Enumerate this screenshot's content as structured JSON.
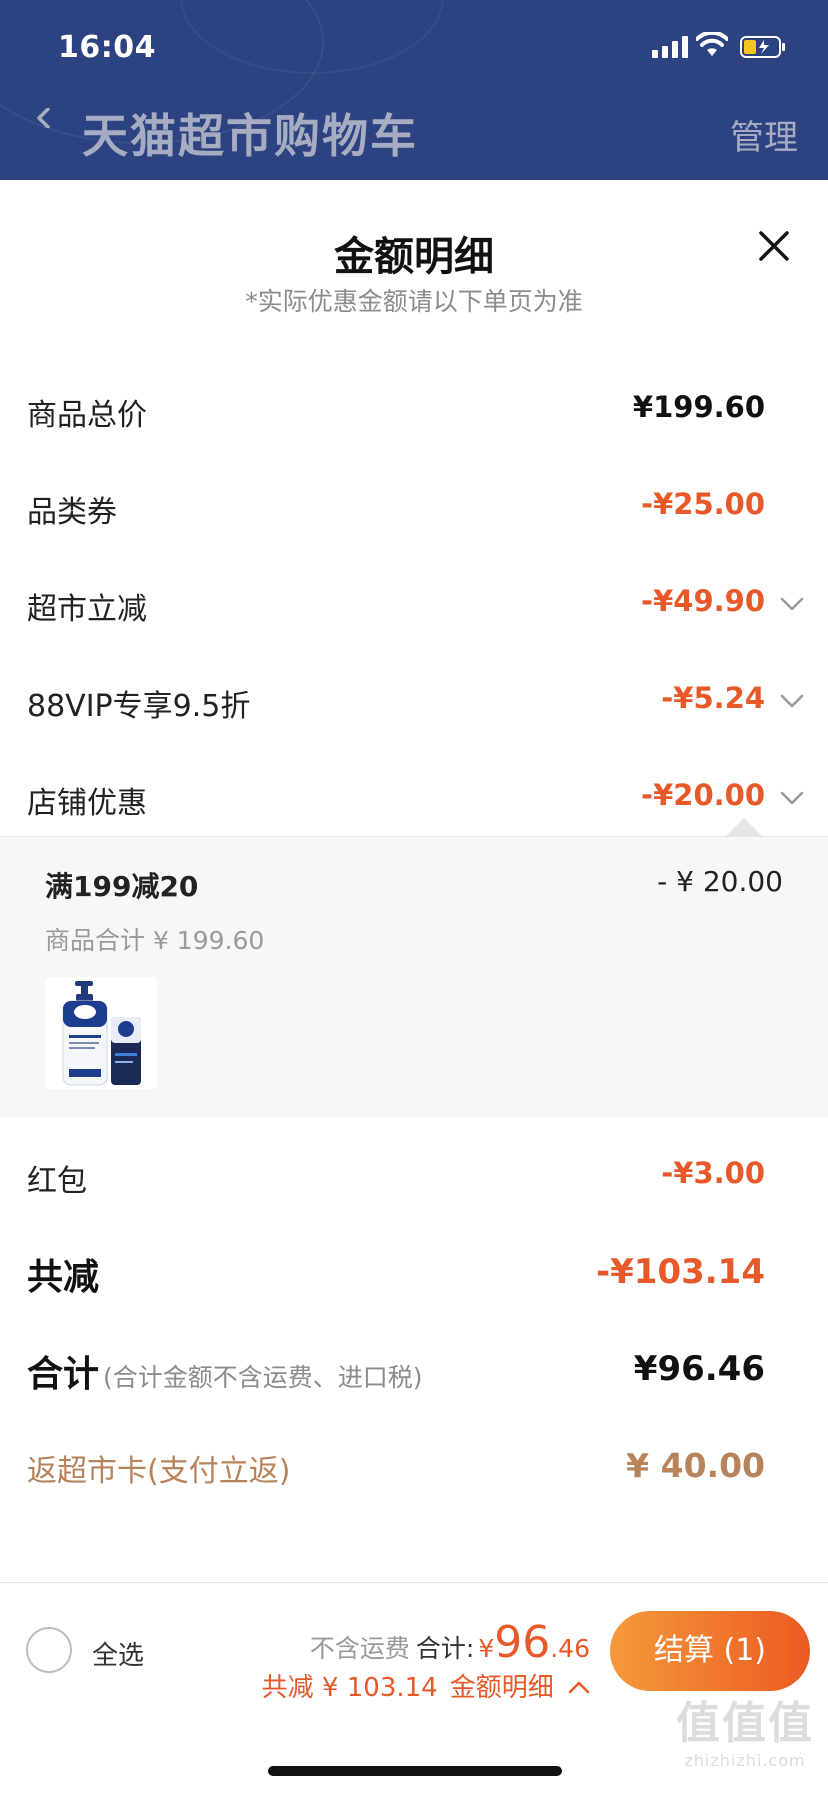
{
  "status_bar": {
    "time": "16:04"
  },
  "nav": {
    "title": "天猫超市购物车",
    "manage_label": "管理"
  },
  "sheet": {
    "title": "金额明细",
    "subtitle": "*实际优惠金额请以下单页为准"
  },
  "rows": {
    "goods_total": {
      "label": "商品总价",
      "value": "¥199.60"
    },
    "category_coupon": {
      "label": "品类券",
      "value": "-¥25.00"
    },
    "market_discount": {
      "label": "超市立减",
      "value": "-¥49.90"
    },
    "vip_discount": {
      "label": "88VIP专享9.5折",
      "value": "-¥5.24"
    },
    "store_discount": {
      "label": "店铺优惠",
      "value": "-¥20.00"
    },
    "red_packet": {
      "label": "红包",
      "value": "-¥3.00"
    },
    "total_saved": {
      "label": "共减",
      "value": "-¥103.14"
    },
    "subtotal": {
      "label": "合计",
      "note": "(合计金额不含运费、进口税)",
      "value": "¥96.46"
    },
    "cashback": {
      "label": "返超市卡(支付立返)",
      "value": "¥ 40.00"
    }
  },
  "store_promo": {
    "title": "满199减20",
    "amount": "- ¥ 20.00",
    "subtotal": "商品合计 ¥ 199.60"
  },
  "bottom": {
    "select_all": "全选",
    "no_shipping": "不含运费",
    "total_label": "合计:",
    "yen": "¥",
    "total_int": "96",
    "total_dec": ".46",
    "saved": "共减 ¥ 103.14",
    "detail_label": "金额明细",
    "checkout_label": "结算 (1)"
  },
  "watermark": {
    "line1": "值值值",
    "line2": "zhizhizhi.com"
  },
  "colors": {
    "nav_bg": "#2d4281",
    "discount": "#e8592a",
    "cashback": "#b6835a"
  }
}
